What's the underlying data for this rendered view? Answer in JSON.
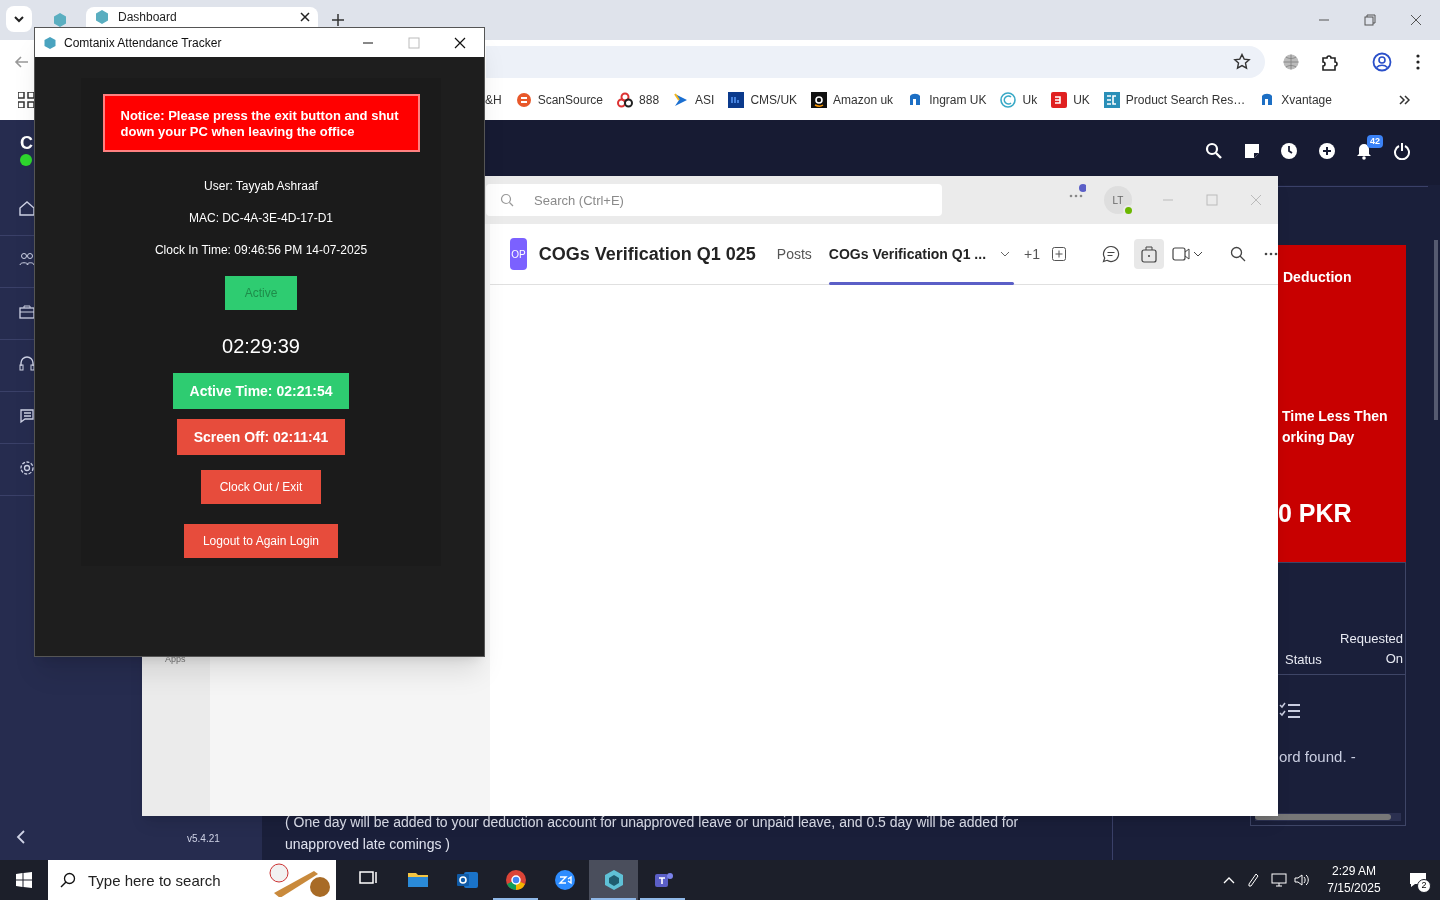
{
  "browser": {
    "tabs": [
      {
        "label": "Dashboard",
        "selected": true
      }
    ],
    "bookmarks": [
      {
        "label": "&H",
        "kind": "none"
      },
      {
        "label": "ScanSource",
        "kind": "scansource"
      },
      {
        "label": "888",
        "kind": "rings"
      },
      {
        "label": "ASI",
        "kind": "arrow"
      },
      {
        "label": "CMS/UK",
        "kind": "di"
      },
      {
        "label": "Amazon uk",
        "kind": "amazon"
      },
      {
        "label": "Ingram UK",
        "kind": "ingram"
      },
      {
        "label": "Uk",
        "kind": "circle"
      },
      {
        "label": "UK",
        "kind": "ex"
      },
      {
        "label": "Product Search Res…",
        "kind": "ec"
      },
      {
        "label": "Xvantage",
        "kind": "ingram"
      }
    ]
  },
  "dashboard": {
    "brand": "C",
    "nav": [
      {
        "kind": "home"
      },
      {
        "kind": "people"
      },
      {
        "kind": "briefcase"
      },
      {
        "kind": "headset"
      },
      {
        "kind": "list"
      },
      {
        "kind": "settings"
      }
    ],
    "version": "v5.4.21",
    "notification_count": "42",
    "deduction_card": {
      "title": "Deduction",
      "lines": [
        "Time Less Then",
        "orking Day"
      ],
      "amount": "0 PKR"
    },
    "table": {
      "columns": [
        "Status",
        "Requested On"
      ],
      "empty_text": "ord found. -"
    },
    "note": [
      "( One day will be added to your deduction account for unapproved leave or unpaid leave, and 0.5 day will be added for",
      "unapproved late comings )"
    ]
  },
  "teams": {
    "search": {
      "placeholder": "Search (Ctrl+E)"
    },
    "avatar": "LT",
    "rail_label": "Apps",
    "channel_avatar": "OP",
    "channel_title": "COGs Verification Q1 025",
    "tabs": [
      {
        "label": "Posts",
        "selected": false
      },
      {
        "label": "COGs Verification Q1 ...",
        "selected": true
      }
    ],
    "more_tabs": "+1"
  },
  "tracker": {
    "title": "Comtanix Attendance Tracker",
    "notice": "Notice: Please press the exit button and shut down your PC when leaving the office",
    "info": [
      "User: Tayyab Ashraaf",
      "MAC: DC-4A-3E-4D-17-D1",
      "Clock In Time: 09:46:56 PM 14-07-2025"
    ],
    "status": "Active",
    "timer": "02:29:39",
    "stats": [
      {
        "label": "Active Time: 02:21:54",
        "kind": "good"
      },
      {
        "label": "Screen Off: 02:11:41",
        "kind": "bad"
      }
    ],
    "buttons": [
      "Clock Out / Exit",
      "Logout to Again Login"
    ]
  },
  "taskbar": {
    "search": {
      "placeholder": "Type here to search"
    },
    "apps": [
      {
        "kind": "taskview",
        "running": false,
        "selected": false
      },
      {
        "kind": "explorer",
        "running": false,
        "selected": false
      },
      {
        "kind": "outlook",
        "running": false,
        "selected": false
      },
      {
        "kind": "chrome",
        "running": true,
        "selected": false
      },
      {
        "kind": "zoom",
        "running": false,
        "selected": false
      },
      {
        "kind": "tracker",
        "running": true,
        "selected": true
      },
      {
        "kind": "teams",
        "running": true,
        "selected": false
      }
    ],
    "time": "2:29 AM",
    "date": "7/15/2025",
    "notifications": "2"
  }
}
